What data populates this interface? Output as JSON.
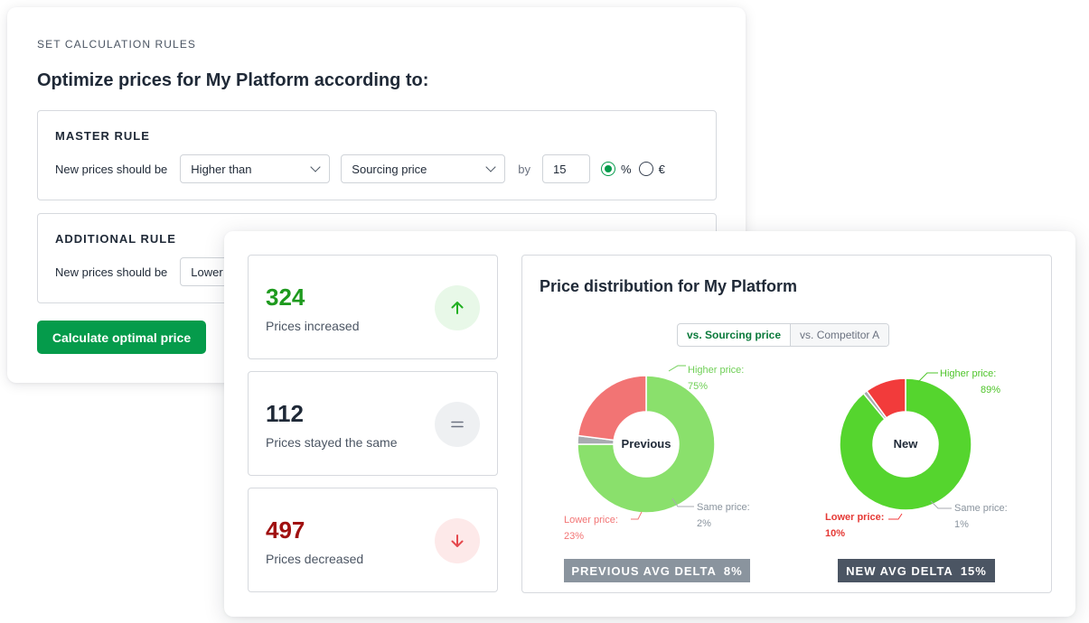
{
  "rules": {
    "eyebrow": "SET CALCULATION RULES",
    "title": "Optimize prices for My Platform according to:",
    "master": {
      "heading": "MASTER RULE",
      "text": "New prices should be",
      "comparison": "Higher than",
      "reference": "Sourcing price",
      "by": "by",
      "amount": "15",
      "unit_percent": "%",
      "unit_euro": "€",
      "selected_unit": "%"
    },
    "additional": {
      "heading": "ADDITIONAL RULE",
      "text": "New prices should be",
      "comparison": "Lower"
    },
    "calculate_label": "Calculate optimal price"
  },
  "stats": [
    {
      "value": "324",
      "label": "Prices increased",
      "icon": "arrow-up-icon"
    },
    {
      "value": "112",
      "label": "Prices stayed the same",
      "icon": "equals-icon"
    },
    {
      "value": "497",
      "label": "Prices decreased",
      "icon": "arrow-down-icon"
    }
  ],
  "distribution": {
    "title": "Price distribution for My Platform",
    "toggle": {
      "active": "vs. Sourcing price",
      "inactive": "vs. Competitor A"
    },
    "colors": {
      "higher_prev": "#8ae06c",
      "lower_prev": "#f27474",
      "same": "#a8abb0",
      "higher_new": "#55d52e",
      "lower_new": "#f23b3b"
    },
    "previous": {
      "center": "Previous",
      "higher_label": "Higher price:",
      "higher_value": "75%",
      "same_label": "Same price:",
      "same_value": "2%",
      "lower_label": "Lower price:",
      "lower_value": "23%",
      "delta_label": "PREVIOUS AVG DELTA",
      "delta_value": "8%"
    },
    "new": {
      "center": "New",
      "higher_label": "Higher price:",
      "higher_value": "89%",
      "same_label": "Same price:",
      "same_value": "1%",
      "lower_label": "Lower price:",
      "lower_value": "10%",
      "delta_label": "NEW AVG DELTA",
      "delta_value": "15%"
    }
  },
  "chart_data": [
    {
      "type": "pie",
      "title": "Previous",
      "categories": [
        "Higher price",
        "Same price",
        "Lower price"
      ],
      "values": [
        75,
        2,
        23
      ]
    },
    {
      "type": "pie",
      "title": "New",
      "categories": [
        "Higher price",
        "Same price",
        "Lower price"
      ],
      "values": [
        89,
        1,
        10
      ]
    }
  ]
}
